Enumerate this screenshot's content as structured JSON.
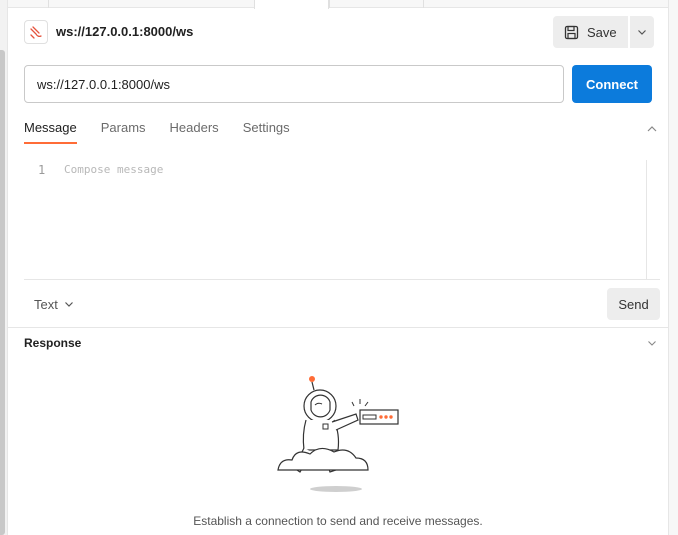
{
  "request": {
    "title": "ws://127.0.0.1:8000/ws",
    "url": "ws://127.0.0.1:8000/ws",
    "icon": "websocket-icon"
  },
  "toolbar": {
    "save_label": "Save",
    "connect_label": "Connect"
  },
  "tabs": [
    {
      "label": "Message",
      "active": true
    },
    {
      "label": "Params",
      "active": false
    },
    {
      "label": "Headers",
      "active": false
    },
    {
      "label": "Settings",
      "active": false
    }
  ],
  "editor": {
    "line_number": "1",
    "placeholder": "Compose message"
  },
  "message_footer": {
    "format": "Text",
    "send_label": "Send"
  },
  "response": {
    "title": "Response",
    "empty_message": "Establish a connection to send and receive messages."
  },
  "colors": {
    "accent": "#ff6c37",
    "primary": "#0c7bdc"
  }
}
